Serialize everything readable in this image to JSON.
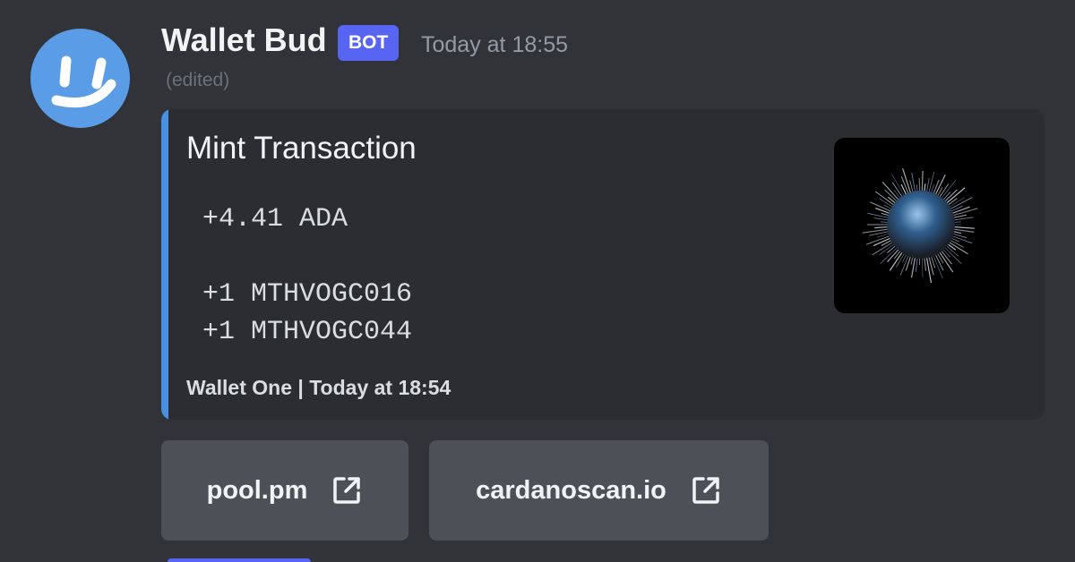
{
  "message": {
    "author": "Wallet Bud",
    "bot_badge": "BOT",
    "timestamp": "Today at 18:55",
    "edited_label": "(edited)",
    "avatar_icon": "smiley-face-icon",
    "avatar_color": "#5a9de6"
  },
  "embed": {
    "accent_color": "#4a90e2",
    "title": "Mint Transaction",
    "description": " +4.41 ADA\n\n +1 MTHVOGC016\n +1 MTHVOGC044",
    "footer": "Wallet One | Today at 18:54",
    "thumbnail_icon": "spiky-sphere-nft-image"
  },
  "buttons": [
    {
      "label": "pool.pm",
      "icon": "external-link-icon"
    },
    {
      "label": "cardanoscan.io",
      "icon": "external-link-icon"
    }
  ],
  "colors": {
    "background": "#313338",
    "embed_background": "#2b2d31",
    "button_background": "#4e5058",
    "bot_badge": "#5865f2"
  }
}
